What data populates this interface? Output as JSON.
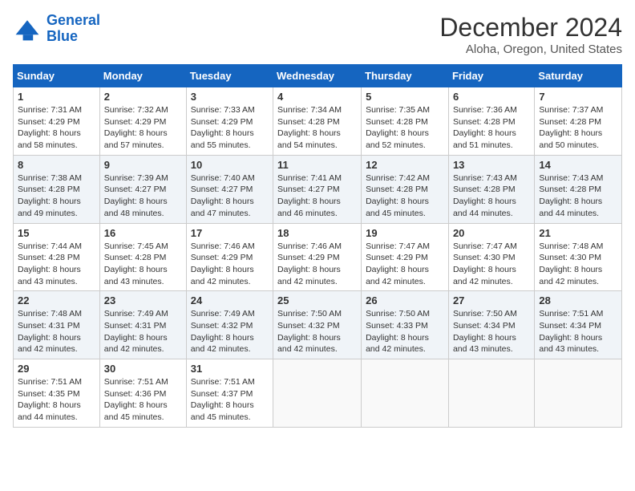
{
  "logo": {
    "line1": "General",
    "line2": "Blue"
  },
  "title": "December 2024",
  "location": "Aloha, Oregon, United States",
  "days_of_week": [
    "Sunday",
    "Monday",
    "Tuesday",
    "Wednesday",
    "Thursday",
    "Friday",
    "Saturday"
  ],
  "weeks": [
    [
      {
        "day": "1",
        "sunrise": "7:31 AM",
        "sunset": "4:29 PM",
        "daylight": "8 hours and 58 minutes."
      },
      {
        "day": "2",
        "sunrise": "7:32 AM",
        "sunset": "4:29 PM",
        "daylight": "8 hours and 57 minutes."
      },
      {
        "day": "3",
        "sunrise": "7:33 AM",
        "sunset": "4:29 PM",
        "daylight": "8 hours and 55 minutes."
      },
      {
        "day": "4",
        "sunrise": "7:34 AM",
        "sunset": "4:28 PM",
        "daylight": "8 hours and 54 minutes."
      },
      {
        "day": "5",
        "sunrise": "7:35 AM",
        "sunset": "4:28 PM",
        "daylight": "8 hours and 52 minutes."
      },
      {
        "day": "6",
        "sunrise": "7:36 AM",
        "sunset": "4:28 PM",
        "daylight": "8 hours and 51 minutes."
      },
      {
        "day": "7",
        "sunrise": "7:37 AM",
        "sunset": "4:28 PM",
        "daylight": "8 hours and 50 minutes."
      }
    ],
    [
      {
        "day": "8",
        "sunrise": "7:38 AM",
        "sunset": "4:28 PM",
        "daylight": "8 hours and 49 minutes."
      },
      {
        "day": "9",
        "sunrise": "7:39 AM",
        "sunset": "4:27 PM",
        "daylight": "8 hours and 48 minutes."
      },
      {
        "day": "10",
        "sunrise": "7:40 AM",
        "sunset": "4:27 PM",
        "daylight": "8 hours and 47 minutes."
      },
      {
        "day": "11",
        "sunrise": "7:41 AM",
        "sunset": "4:27 PM",
        "daylight": "8 hours and 46 minutes."
      },
      {
        "day": "12",
        "sunrise": "7:42 AM",
        "sunset": "4:28 PM",
        "daylight": "8 hours and 45 minutes."
      },
      {
        "day": "13",
        "sunrise": "7:43 AM",
        "sunset": "4:28 PM",
        "daylight": "8 hours and 44 minutes."
      },
      {
        "day": "14",
        "sunrise": "7:43 AM",
        "sunset": "4:28 PM",
        "daylight": "8 hours and 44 minutes."
      }
    ],
    [
      {
        "day": "15",
        "sunrise": "7:44 AM",
        "sunset": "4:28 PM",
        "daylight": "8 hours and 43 minutes."
      },
      {
        "day": "16",
        "sunrise": "7:45 AM",
        "sunset": "4:28 PM",
        "daylight": "8 hours and 43 minutes."
      },
      {
        "day": "17",
        "sunrise": "7:46 AM",
        "sunset": "4:29 PM",
        "daylight": "8 hours and 42 minutes."
      },
      {
        "day": "18",
        "sunrise": "7:46 AM",
        "sunset": "4:29 PM",
        "daylight": "8 hours and 42 minutes."
      },
      {
        "day": "19",
        "sunrise": "7:47 AM",
        "sunset": "4:29 PM",
        "daylight": "8 hours and 42 minutes."
      },
      {
        "day": "20",
        "sunrise": "7:47 AM",
        "sunset": "4:30 PM",
        "daylight": "8 hours and 42 minutes."
      },
      {
        "day": "21",
        "sunrise": "7:48 AM",
        "sunset": "4:30 PM",
        "daylight": "8 hours and 42 minutes."
      }
    ],
    [
      {
        "day": "22",
        "sunrise": "7:48 AM",
        "sunset": "4:31 PM",
        "daylight": "8 hours and 42 minutes."
      },
      {
        "day": "23",
        "sunrise": "7:49 AM",
        "sunset": "4:31 PM",
        "daylight": "8 hours and 42 minutes."
      },
      {
        "day": "24",
        "sunrise": "7:49 AM",
        "sunset": "4:32 PM",
        "daylight": "8 hours and 42 minutes."
      },
      {
        "day": "25",
        "sunrise": "7:50 AM",
        "sunset": "4:32 PM",
        "daylight": "8 hours and 42 minutes."
      },
      {
        "day": "26",
        "sunrise": "7:50 AM",
        "sunset": "4:33 PM",
        "daylight": "8 hours and 42 minutes."
      },
      {
        "day": "27",
        "sunrise": "7:50 AM",
        "sunset": "4:34 PM",
        "daylight": "8 hours and 43 minutes."
      },
      {
        "day": "28",
        "sunrise": "7:51 AM",
        "sunset": "4:34 PM",
        "daylight": "8 hours and 43 minutes."
      }
    ],
    [
      {
        "day": "29",
        "sunrise": "7:51 AM",
        "sunset": "4:35 PM",
        "daylight": "8 hours and 44 minutes."
      },
      {
        "day": "30",
        "sunrise": "7:51 AM",
        "sunset": "4:36 PM",
        "daylight": "8 hours and 45 minutes."
      },
      {
        "day": "31",
        "sunrise": "7:51 AM",
        "sunset": "4:37 PM",
        "daylight": "8 hours and 45 minutes."
      },
      null,
      null,
      null,
      null
    ]
  ],
  "labels": {
    "sunrise": "Sunrise:",
    "sunset": "Sunset:",
    "daylight": "Daylight:"
  }
}
